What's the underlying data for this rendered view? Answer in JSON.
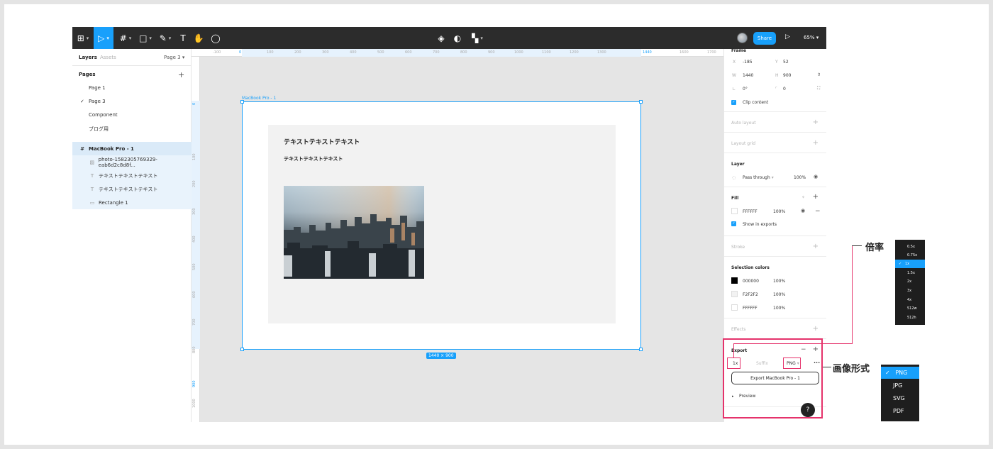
{
  "toolbar": {
    "share_label": "Share",
    "zoom_label": "65%",
    "play_icon": "play-icon"
  },
  "left_panel": {
    "tabs": {
      "layers": "Layers",
      "assets": "Assets",
      "page_select": "Page 3"
    },
    "pages_title": "Pages",
    "pages": [
      "Page 1",
      "Page 3",
      "Component",
      "ブログ用"
    ],
    "current_page": "Page 3",
    "layers": [
      {
        "label": "MacBook Pro - 1",
        "icon": "frame-icon"
      },
      {
        "label": "photo-1582305769329-eab6d2c8d8f...",
        "icon": "image-icon"
      },
      {
        "label": "テキストテキストテキスト",
        "icon": "text-icon"
      },
      {
        "label": "テキストテキストテキスト",
        "icon": "text-icon"
      },
      {
        "label": "Rectangle 1",
        "icon": "rectangle-icon"
      }
    ]
  },
  "rulers": {
    "top": [
      "-100",
      "0",
      "100",
      "200",
      "300",
      "400",
      "500",
      "600",
      "700",
      "800",
      "900",
      "1000",
      "1100",
      "1200",
      "1300",
      "1440",
      "1600",
      "1700"
    ],
    "left": [
      "0",
      "100",
      "200",
      "300",
      "400",
      "500",
      "600",
      "700",
      "800",
      "900",
      "1000",
      "1100"
    ]
  },
  "canvas": {
    "frame_label": "MacBook Pro - 1",
    "heading": "テキストテキストテキスト",
    "subheading": "テキストテキストテキスト",
    "size_badge": "1440 × 900"
  },
  "right_panel": {
    "frame_title": "Frame",
    "x_label": "X",
    "x_value": "-185",
    "y_label": "Y",
    "y_value": "52",
    "w_label": "W",
    "w_value": "1440",
    "h_label": "H",
    "h_value": "900",
    "rotation_value": "0°",
    "radius_value": "0",
    "clip_content": "Clip content",
    "auto_layout": "Auto layout",
    "layout_grid": "Layout grid",
    "layer_title": "Layer",
    "blend_mode": "Pass through",
    "layer_opacity": "100%",
    "fill_title": "Fill",
    "fill_hex": "FFFFFF",
    "fill_opacity": "100%",
    "show_in_exports": "Show in exports",
    "stroke": "Stroke",
    "selection_colors_title": "Selection colors",
    "selection_colors": [
      {
        "hex": "000000",
        "opacity": "100%",
        "color": "#000000"
      },
      {
        "hex": "F2F2F2",
        "opacity": "100%",
        "color": "#F2F2F2"
      },
      {
        "hex": "FFFFFF",
        "opacity": "100%",
        "color": "#FFFFFF"
      }
    ],
    "effects": "Effects",
    "export_title": "Export",
    "export_scale": "1x",
    "export_suffix_placeholder": "Suffix",
    "export_format": "PNG",
    "export_button": "Export MacBook Pro - 1",
    "preview": "Preview"
  },
  "annotations": {
    "scale_label": "倍率",
    "format_label": "画像形式"
  },
  "scale_menu": {
    "options": [
      "0.5x",
      "0.75x",
      "1x",
      "1.5x",
      "2x",
      "3x",
      "4x",
      "512w",
      "512h"
    ],
    "selected": "1x"
  },
  "format_menu": {
    "options": [
      "PNG",
      "JPG",
      "SVG",
      "PDF"
    ],
    "selected": "PNG"
  },
  "help_label": "?",
  "colors": {
    "accent": "#18a0fb",
    "highlight": "#e5326b",
    "toolbar": "#2c2c2c"
  }
}
